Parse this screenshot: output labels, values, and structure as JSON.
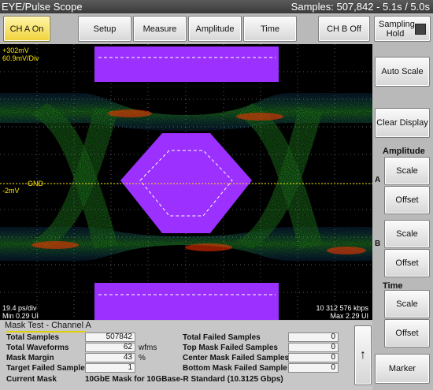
{
  "titlebar": {
    "title": "EYE/Pulse Scope",
    "samples_status": "Samples: 507,842 - 5.1s / 5.0s"
  },
  "toolbar": {
    "ch_a": "CH A On",
    "setup": "Setup",
    "measure": "Measure",
    "amplitude": "Amplitude",
    "time": "Time",
    "ch_b": "CH B Off",
    "sampling_hold": "Sampling Hold"
  },
  "scope": {
    "top_voltage": "+302mV",
    "volts_per_div": "60.9mV/Div",
    "gnd_label": "GND",
    "offset": "-2mV",
    "time_per_div": "19.4 ps/div",
    "min_ui": "Min 0.29 UI",
    "bitrate": "10 312 576 kbps",
    "max_ui": "Max 2.29 UI"
  },
  "right": {
    "auto_scale": "Auto Scale",
    "clear_display": "Clear Display",
    "amplitude_label": "Amplitude",
    "ch_a_marker": "A",
    "ch_b_marker": "B",
    "scale": "Scale",
    "offset": "Offset",
    "time_label": "Time",
    "marker": "Marker"
  },
  "mask": {
    "title": "Mask Test - Channel A",
    "total_samples_label": "Total Samples",
    "total_samples": "507842",
    "total_waveforms_label": "Total Waveforms",
    "total_waveforms": "62",
    "wfms_unit": "wfms",
    "mask_margin_label": "Mask Margin",
    "mask_margin": "43",
    "percent_unit": "%",
    "target_failed_label": "Target Failed Sample",
    "target_failed": "1",
    "total_failed_label": "Total Failed Samples",
    "total_failed": "0",
    "top_failed_label": "Top Mask Failed Samples",
    "top_failed": "0",
    "center_failed_label": "Center Mask Failed Samples",
    "center_failed": "0",
    "bottom_failed_label": "Bottom Mask Failed Sample",
    "bottom_failed": "0",
    "current_mask_label": "Current Mask",
    "current_mask": "10GbE Mask for 10GBase-R Standard  (10.3125 Gbps)",
    "scroll_up": "↑"
  },
  "colors": {
    "mask_purple": "#9b30ff",
    "trace_hot": "#ff3300",
    "trace_mid": "#33cc33",
    "trace_cool": "#1f7fd6",
    "active_button": "#f0d23a"
  }
}
